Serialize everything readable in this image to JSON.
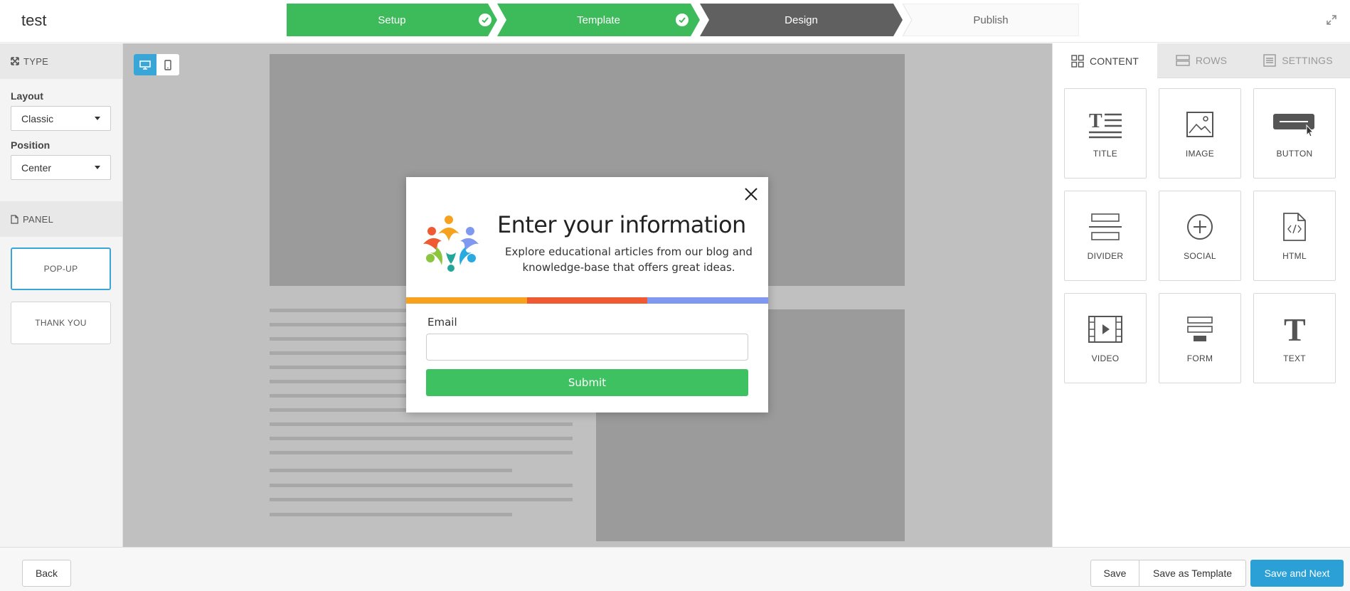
{
  "app": {
    "title": "test"
  },
  "steps": [
    {
      "label": "Setup",
      "state": "done"
    },
    {
      "label": "Template",
      "state": "done"
    },
    {
      "label": "Design",
      "state": "current"
    },
    {
      "label": "Publish",
      "state": "todo"
    }
  ],
  "left_panel": {
    "type_header": "TYPE",
    "layout_label": "Layout",
    "layout_value": "Classic",
    "position_label": "Position",
    "position_value": "Center",
    "panel_header": "PANEL",
    "panels": [
      "POP-UP",
      "THANK YOU"
    ]
  },
  "popup": {
    "title": "Enter your information",
    "description": "Explore educational articles from our blog and knowledge-base that offers great ideas.",
    "email_label": "Email",
    "email_value": "",
    "submit_label": "Submit",
    "stripe_colors": [
      "#f6a21e",
      "#f05a33",
      "#7f99f0"
    ],
    "submit_color": "#3ec161"
  },
  "right_panel": {
    "tabs": [
      "CONTENT",
      "ROWS",
      "SETTINGS"
    ],
    "tiles": [
      "TITLE",
      "IMAGE",
      "BUTTON",
      "DIVIDER",
      "SOCIAL",
      "HTML",
      "VIDEO",
      "FORM",
      "TEXT"
    ]
  },
  "bottom": {
    "back": "Back",
    "save": "Save",
    "save_template": "Save as Template",
    "save_next": "Save and Next"
  },
  "colors": {
    "step_done": "#3dbb5b",
    "step_current": "#606060",
    "accent": "#2aa0d7"
  }
}
